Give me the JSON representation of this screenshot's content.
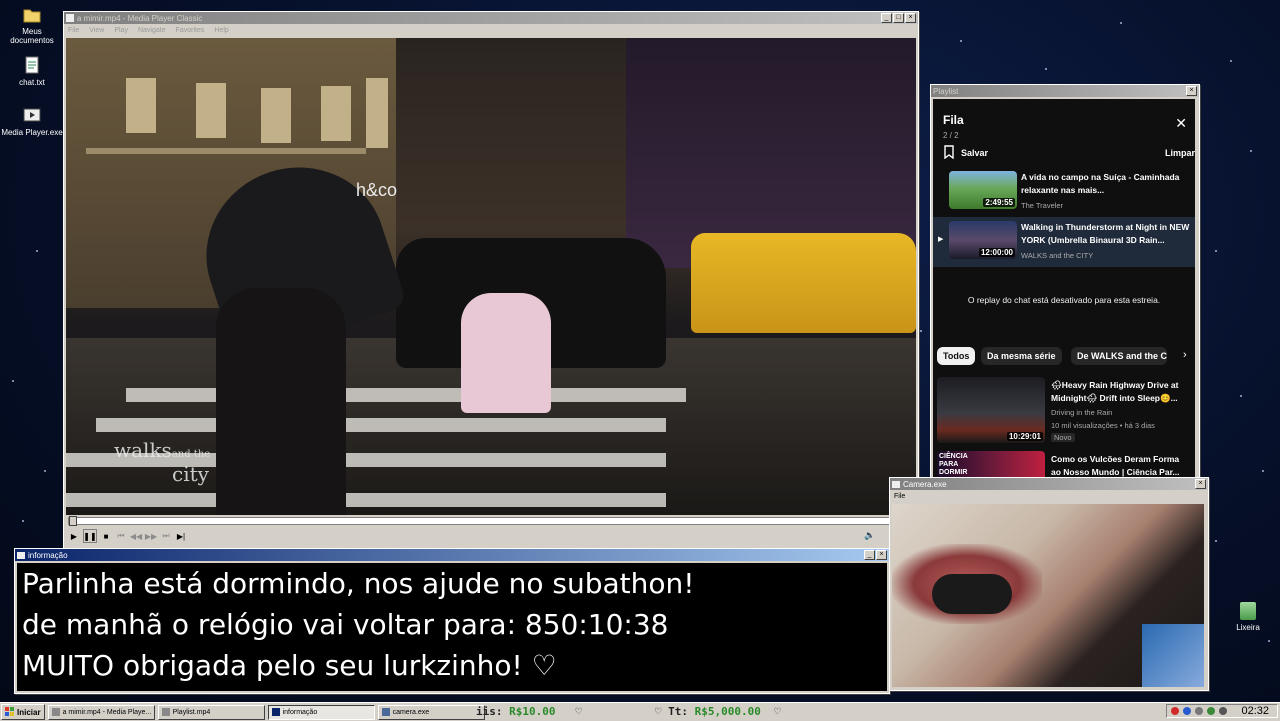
{
  "desktop": {
    "icons": [
      {
        "label": "Meus documentos"
      },
      {
        "label": "chat.txt"
      },
      {
        "label": "Media Player.exe"
      },
      {
        "label": "Lixeira"
      }
    ]
  },
  "player": {
    "title": "a mimir.mp4 - Media Player Classic",
    "menu": [
      "File",
      "View",
      "Play",
      "Navigate",
      "Favorites",
      "Help"
    ],
    "watermark_main": "walks",
    "watermark_small": "and the",
    "watermark_city": "city",
    "storefront_sign": "h&co",
    "progress": 0.0
  },
  "playlist": {
    "window_title": "Playlist",
    "heading": "Fila",
    "counter": "2 / 2",
    "save_label": "Salvar",
    "clear_label": "Limpar",
    "items": [
      {
        "title": "A vida no campo na Suíça - Caminhada relaxante nas mais...",
        "channel": "The Traveler",
        "duration": "2:49:55"
      },
      {
        "title": "Walking in Thunderstorm at Night in NEW YORK (Umbrella Binaural 3D Rain...",
        "channel": "WALKS and the CITY",
        "duration": "12:00:00"
      }
    ],
    "chat_disabled": "O replay do chat está desativado para esta estreia.",
    "chips": [
      "Todos",
      "Da mesma série",
      "De WALKS and the CI"
    ],
    "recommendations": [
      {
        "title": "🌧Heavy Rain Highway Drive at Midnight🌧 Drift into Sleep😊...",
        "channel": "Driving in the Rain",
        "meta": "10 mil visualizações • há 3 dias",
        "badge": "Novo",
        "duration": "10:29:01"
      },
      {
        "title": "Como os Vulcões Deram Forma ao Nosso Mundo | Ciência Par...",
        "thumb_text": "CIÊNCIA PARA DORMIR"
      }
    ]
  },
  "info": {
    "window_title": "informação",
    "lines": [
      "Parlinha está dormindo, nos ajude no subathon!",
      "de manhã o relógio vai voltar para:  850:10:38",
      "MUITO obrigada pelo seu lurkzinho! ♡"
    ]
  },
  "camera": {
    "window_title": "Camera.exe",
    "menu": [
      "File"
    ]
  },
  "taskbar": {
    "start_label": "Iniciar",
    "tasks": [
      {
        "label": "a mimir.mp4 - Media Playe..."
      },
      {
        "label": "Playlist.mp4"
      },
      {
        "label": "informação"
      },
      {
        "label": "camera.exe"
      }
    ],
    "ticker_prefix": "iis:",
    "ticker_value_1": "R$10.00",
    "ticker_heart": "♡",
    "ticker_label_2": "Tt:",
    "ticker_value_2": "R$5,000.00",
    "clock": "02:32"
  }
}
